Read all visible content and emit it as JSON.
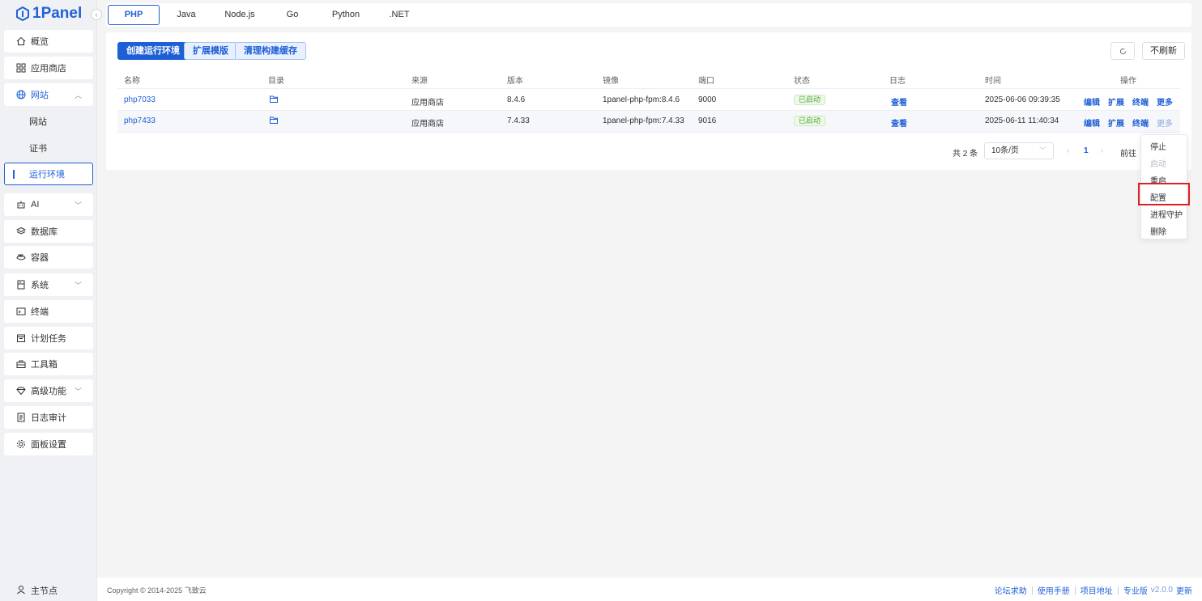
{
  "app": {
    "logo": "1Panel"
  },
  "sidebar": {
    "items": [
      {
        "label": "概览",
        "icon": "home-icon"
      },
      {
        "label": "应用商店",
        "icon": "grid-icon"
      },
      {
        "label": "网站",
        "icon": "globe-icon",
        "expanded": true
      },
      {
        "label": "AI",
        "icon": "robot-icon"
      },
      {
        "label": "数据库",
        "icon": "layers-icon"
      },
      {
        "label": "容器",
        "icon": "container-icon"
      },
      {
        "label": "系统",
        "icon": "server-icon"
      },
      {
        "label": "终端",
        "icon": "terminal-icon"
      },
      {
        "label": "计划任务",
        "icon": "calendar-icon"
      },
      {
        "label": "工具箱",
        "icon": "toolbox-icon"
      },
      {
        "label": "高级功能",
        "icon": "diamond-icon"
      },
      {
        "label": "日志审计",
        "icon": "log-icon"
      },
      {
        "label": "面板设置",
        "icon": "gear-icon"
      }
    ],
    "website_sub": [
      "网站",
      "证书",
      "运行环境"
    ],
    "node": "主节点"
  },
  "tabs": [
    "PHP",
    "Java",
    "Node.js",
    "Go",
    "Python",
    ".NET"
  ],
  "toolbar": {
    "create": "创建运行环境",
    "ext_template": "扩展模版",
    "clear_cache": "清理构建缓存",
    "no_refresh": "不刷新"
  },
  "table": {
    "headers": [
      "名称",
      "目录",
      "来源",
      "版本",
      "镜像",
      "端口",
      "状态",
      "日志",
      "时间",
      "操作"
    ],
    "rows": [
      {
        "name": "php7033",
        "source": "应用商店",
        "version": "8.4.6",
        "image": "1panel-php-fpm:8.4.6",
        "port": "9000",
        "status": "已启动",
        "log": "查看",
        "time": "2025-06-06 09:39:35"
      },
      {
        "name": "php7433",
        "source": "应用商店",
        "version": "7.4.33",
        "image": "1panel-php-fpm:7.4.33",
        "port": "9016",
        "status": "已启动",
        "log": "查看",
        "time": "2025-06-11 11:40:34"
      }
    ],
    "actions": [
      "编辑",
      "扩展",
      "终端",
      "更多"
    ]
  },
  "pagination": {
    "total": "共 2 条",
    "page_size": "10条/页",
    "current": "1",
    "goto": "前往"
  },
  "dropdown": [
    "停止",
    "启动",
    "重启",
    "配置",
    "进程守护",
    "删除"
  ],
  "footer": {
    "copyright": "Copyright © 2014-2025 飞致云",
    "links": [
      "论坛求助",
      "使用手册",
      "项目地址"
    ],
    "edition": "专业版",
    "version": "v2.0.0",
    "update": "更新"
  },
  "colors": {
    "primary": "#1f5fd6",
    "success": "#52a838",
    "highlight": "#e02020"
  }
}
